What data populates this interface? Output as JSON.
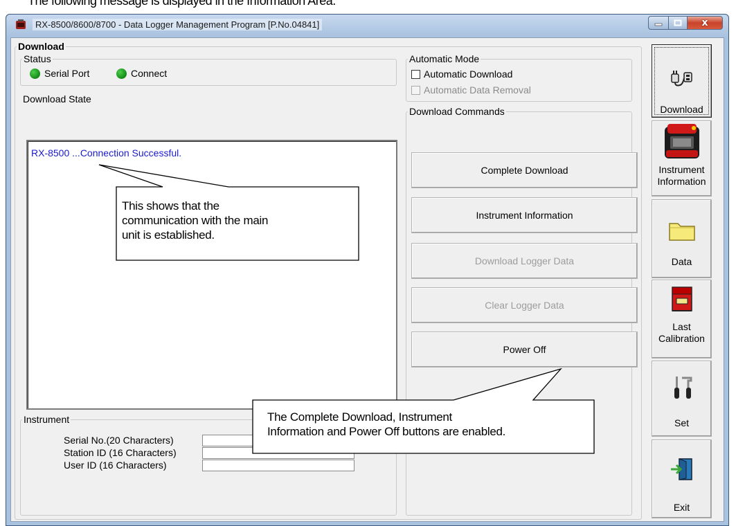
{
  "document_text": "The following message is displayed in the Information Area.",
  "window": {
    "title": "RX-8500/8600/8700 - Data Logger Management Program [P.No.04841]",
    "minimize_icon": "minimize-icon",
    "maximize_icon": "maximize-icon",
    "close_glyph": "x"
  },
  "download": {
    "group_label": "Download",
    "status": {
      "label": "Status",
      "serial_port": "Serial Port",
      "connect": "Connect",
      "led_color": "#1f9e1f"
    },
    "download_state_label": "Download State",
    "info_message": "RX-8500 ...Connection Successful.",
    "automatic_mode": {
      "label": "Automatic Mode",
      "automatic_download": "Automatic Download",
      "automatic_download_checked": false,
      "automatic_data_removal": "Automatic Data Removal",
      "automatic_data_removal_enabled": false
    },
    "commands": {
      "label": "Download Commands",
      "buttons": [
        {
          "label": "Complete Download",
          "enabled": true
        },
        {
          "label": "Instrument Information",
          "enabled": true
        },
        {
          "label": "Download Logger Data",
          "enabled": false
        },
        {
          "label": "Clear Logger Data",
          "enabled": false
        },
        {
          "label": "Power Off",
          "enabled": true
        }
      ]
    },
    "instrument": {
      "label": "Instrument",
      "serial_no_label": "Serial No.(20 Characters)",
      "station_id_label": "Station ID (16 Characters)",
      "user_id_label": "User ID (16 Characters)",
      "serial_no_value": "",
      "station_id_value": "",
      "user_id_value": ""
    }
  },
  "sidebar": {
    "download": {
      "label": "Download",
      "icon": "connector-plug-icon"
    },
    "instrument_information": {
      "line1": "Instrument",
      "line2": "Information",
      "icon": "gas-detector-icon"
    },
    "data": {
      "label": "Data",
      "icon": "folder-icon"
    },
    "last_calibration": {
      "line1": "Last",
      "line2": "Calibration",
      "icon": "red-book-icon"
    },
    "set": {
      "label": "Set",
      "icon": "tools-icon"
    },
    "exit": {
      "label": "Exit",
      "icon": "exit-door-icon"
    }
  },
  "callouts": {
    "connection": {
      "line1": "This shows that the",
      "line2": "communication with the main",
      "line3": "unit is established."
    },
    "buttons": {
      "line1": "The Complete Download, Instrument",
      "line2": "Information and Power Off buttons are enabled."
    }
  },
  "colors": {
    "title_bar": "#a9c2df",
    "info_text": "#1a1acc",
    "close_button": "#c9432a",
    "disabled_text": "#9c9c9c"
  }
}
